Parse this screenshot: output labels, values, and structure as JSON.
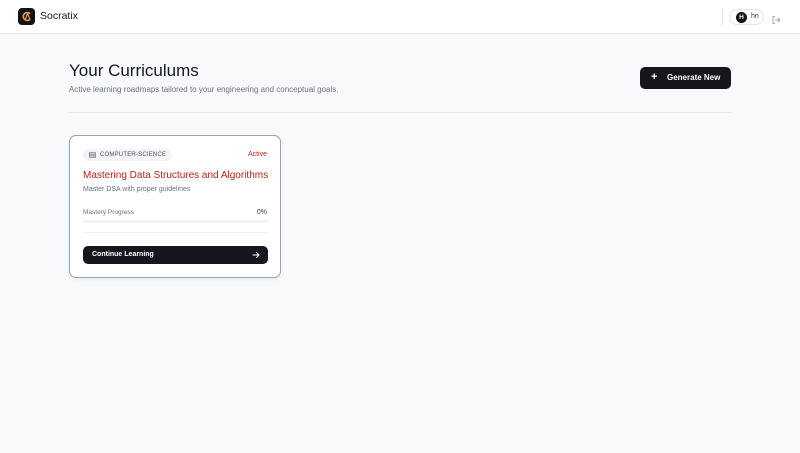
{
  "header": {
    "brand": "Socratix",
    "user_initial": "H",
    "user_name": "hn"
  },
  "main": {
    "title": "Your Curriculums",
    "subtitle": "Active learning roadmaps tailored to your engineering and conceptual goals.",
    "generate_label": "Generate New",
    "generate_icon": "plus-icon"
  },
  "cards": [
    {
      "category": "COMPUTER-SCIENCE",
      "category_icon": "stack-icon",
      "status": "Active",
      "title": "Mastering Data Structures and Algorithms",
      "description": "Master DSA with proper guidelines",
      "progress_label": "Mastery Progress",
      "progress_text": "0%",
      "progress": 0,
      "button_label": "Continue Learning",
      "button_icon": "arrow-right-icon"
    }
  ],
  "colors": {
    "accent_dark": "#15171c",
    "title_red": "#b42318",
    "status_red": "#b91c1c",
    "background": "#f8f9fb"
  }
}
